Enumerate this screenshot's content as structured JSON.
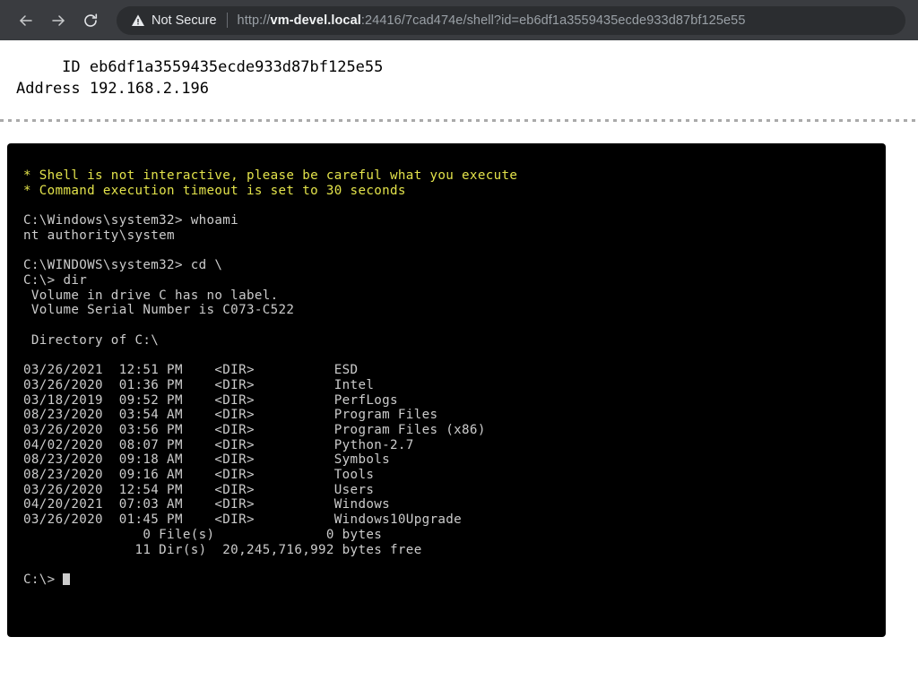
{
  "browser": {
    "back_icon": "arrow-left-icon",
    "forward_icon": "arrow-right-icon",
    "reload_icon": "reload-icon",
    "security": {
      "icon": "warning-triangle-icon",
      "label": "Not Secure"
    },
    "url": {
      "scheme": "http://",
      "host": "vm-devel.local",
      "rest": ":24416/7cad474e/shell?id=eb6df1a3559435ecde933d87bf125e55",
      "full": "http://vm-devel.local:24416/7cad474e/shell?id=eb6df1a3559435ecde933d87bf125e55"
    },
    "colors": {
      "toolbar_bg": "#3a3c40",
      "omnibox_bg": "#2b2d30",
      "text_dim": "#9aa0a6",
      "text_bright": "#f1f3f4"
    }
  },
  "meta": {
    "rows": [
      {
        "label": "ID",
        "value": "eb6df1a3559435ecde933d87bf125e55"
      },
      {
        "label": "Address",
        "value": "192.168.2.196"
      }
    ]
  },
  "terminal": {
    "colors": {
      "background": "#000000",
      "text": "#cccccc",
      "warning": "#e3e34b"
    },
    "warnings": [
      "* Shell is not interactive, please be careful what you execute",
      "* Command execution timeout is set to 30 seconds"
    ],
    "lines": [
      "",
      "C:\\Windows\\system32> whoami",
      "nt authority\\system",
      "",
      "C:\\WINDOWS\\system32> cd \\",
      "C:\\> dir",
      " Volume in drive C has no label.",
      " Volume Serial Number is C073-C522",
      "",
      " Directory of C:\\",
      "",
      "03/26/2021  12:51 PM    <DIR>          ESD",
      "03/26/2020  01:36 PM    <DIR>          Intel",
      "03/18/2019  09:52 PM    <DIR>          PerfLogs",
      "08/23/2020  03:54 AM    <DIR>          Program Files",
      "03/26/2020  03:56 PM    <DIR>          Program Files (x86)",
      "04/02/2020  08:07 PM    <DIR>          Python-2.7",
      "08/23/2020  09:18 AM    <DIR>          Symbols",
      "08/23/2020  09:16 AM    <DIR>          Tools",
      "03/26/2020  12:54 PM    <DIR>          Users",
      "04/20/2021  07:03 AM    <DIR>          Windows",
      "03/26/2020  01:45 PM    <DIR>          Windows10Upgrade",
      "               0 File(s)              0 bytes",
      "              11 Dir(s)  20,245,716,992 bytes free",
      ""
    ],
    "prompt": "C:\\> "
  }
}
